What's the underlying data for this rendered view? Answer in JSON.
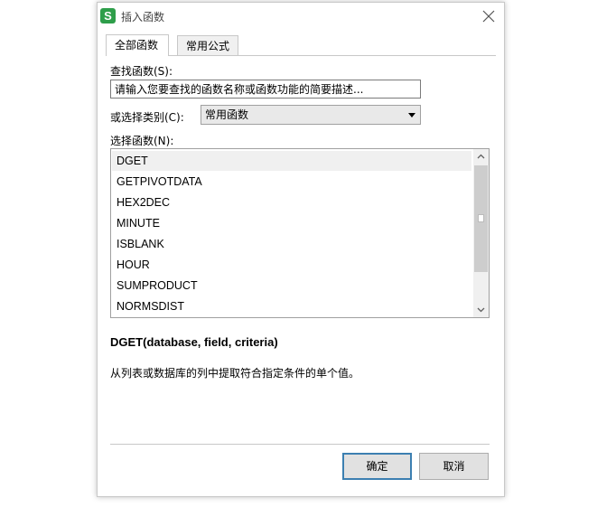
{
  "window": {
    "app_icon_letter": "S",
    "title": "插入函数"
  },
  "tabs": [
    {
      "label": "全部函数",
      "active": true
    },
    {
      "label": "常用公式",
      "active": false
    }
  ],
  "search": {
    "label": "查找函数(S):",
    "value": "请输入您要查找的函数名称或函数功能的简要描述..."
  },
  "category": {
    "label": "或选择类别(C):",
    "selected": "常用函数"
  },
  "functions": {
    "label": "选择函数(N):",
    "items": [
      "DGET",
      "GETPIVOTDATA",
      "HEX2DEC",
      "MINUTE",
      "ISBLANK",
      "HOUR",
      "SUMPRODUCT",
      "NORMSDIST"
    ],
    "selected_index": 0
  },
  "detail": {
    "signature": "DGET(database, field, criteria)",
    "description": "从列表或数据库的列中提取符合指定条件的单个值。"
  },
  "buttons": {
    "ok": "确定",
    "cancel": "取消"
  },
  "colors": {
    "icon_green": "#2e9e4a",
    "ok_border": "#3c7fb1",
    "selection": "#f0f0f0"
  }
}
